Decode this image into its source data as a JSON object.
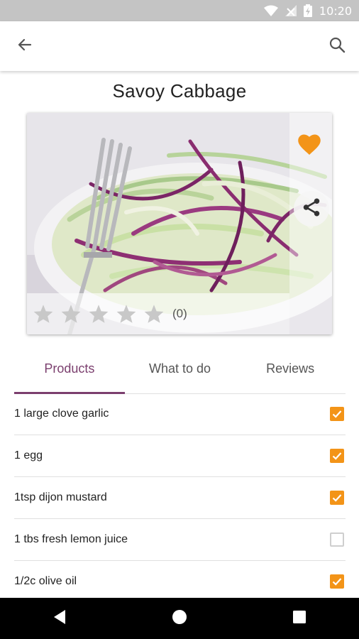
{
  "status_bar": {
    "time": "10:20",
    "icons": [
      "wifi-icon",
      "signal-icon",
      "battery-icon"
    ]
  },
  "app_bar": {
    "back_icon": "arrow-back-icon",
    "search_icon": "search-icon"
  },
  "page": {
    "title": "Savoy Cabbage"
  },
  "hero": {
    "favorite_icon": "heart-icon",
    "share_icon": "share-icon",
    "rating": {
      "stars": 5,
      "value": 0,
      "count_label": "(0)"
    }
  },
  "tabs": [
    {
      "label": "Products",
      "active": true
    },
    {
      "label": "What to do",
      "active": false
    },
    {
      "label": "Reviews",
      "active": false
    }
  ],
  "ingredients": [
    {
      "label": "1 large clove garlic",
      "checked": true
    },
    {
      "label": "1 egg",
      "checked": true
    },
    {
      "label": "1tsp dijon mustard",
      "checked": true
    },
    {
      "label": "1 tbs fresh lemon juice",
      "checked": false
    },
    {
      "label": "1/2c olive oil",
      "checked": true
    }
  ],
  "colors": {
    "accent": "#f39418",
    "tab_active": "#7b3f6e",
    "status_bar": "#c4c4c4"
  },
  "nav_bar": {
    "buttons": [
      "back-triangle-icon",
      "home-circle-icon",
      "recents-square-icon"
    ]
  }
}
